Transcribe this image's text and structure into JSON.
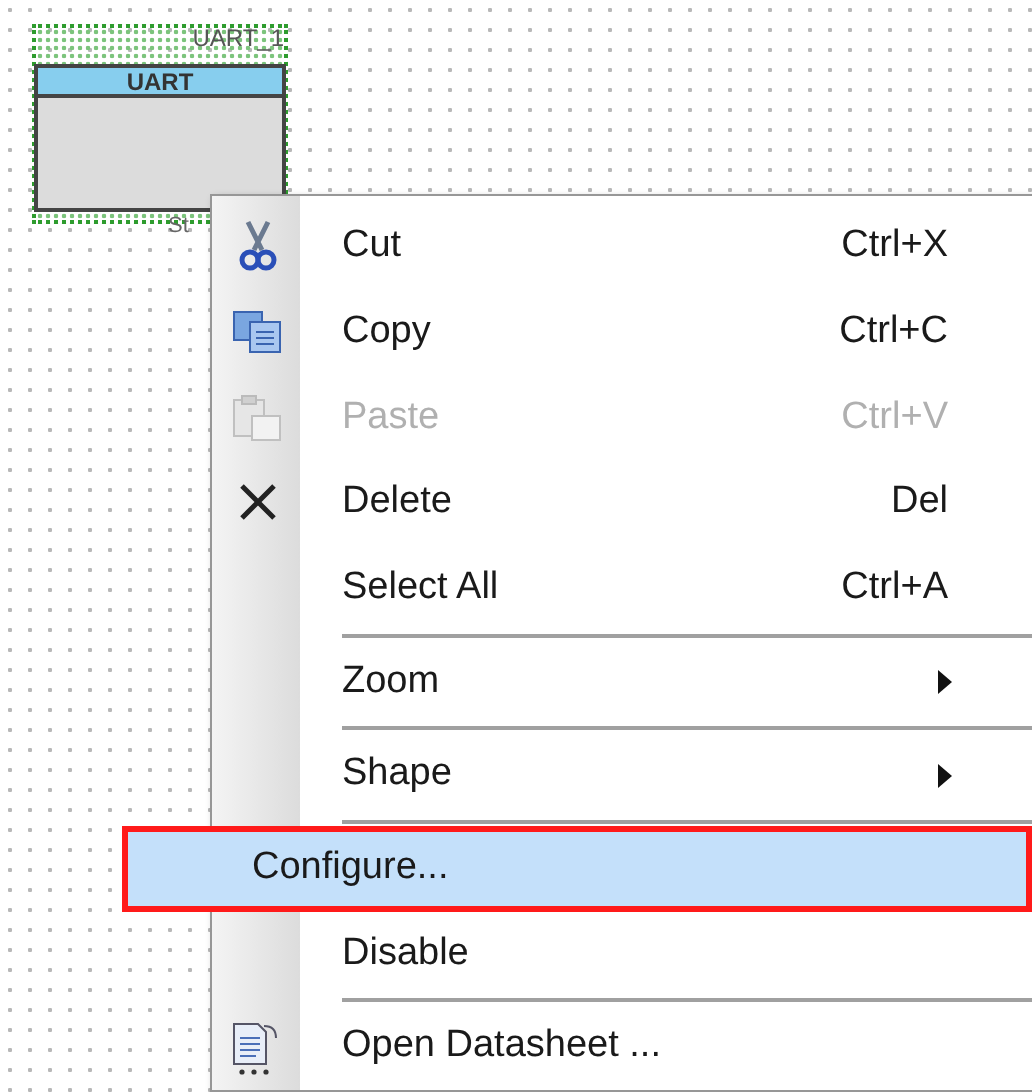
{
  "canvas": {
    "component": {
      "instance_name": "UART_1",
      "title": "UART",
      "terminal_label": "St",
      "selected": true
    }
  },
  "context_menu": {
    "items": [
      {
        "kind": "item",
        "label": "Cut",
        "shortcut": "Ctrl+X",
        "disabled": false,
        "selected": false
      },
      {
        "kind": "item",
        "label": "Copy",
        "shortcut": "Ctrl+C",
        "disabled": false,
        "selected": false
      },
      {
        "kind": "item",
        "label": "Paste",
        "shortcut": "Ctrl+V",
        "disabled": true,
        "selected": false
      },
      {
        "kind": "item",
        "label": "Delete",
        "shortcut": "Del",
        "disabled": false,
        "selected": false
      },
      {
        "kind": "item",
        "label": "Select All",
        "shortcut": "Ctrl+A",
        "disabled": false,
        "selected": false
      },
      {
        "kind": "separator"
      },
      {
        "kind": "submenu",
        "label": "Zoom",
        "disabled": false,
        "selected": false
      },
      {
        "kind": "separator"
      },
      {
        "kind": "submenu",
        "label": "Shape",
        "disabled": false,
        "selected": false
      },
      {
        "kind": "separator"
      },
      {
        "kind": "item",
        "label": "Configure...",
        "disabled": false,
        "selected": true
      },
      {
        "kind": "item",
        "label": "Disable",
        "disabled": false,
        "selected": false
      },
      {
        "kind": "separator"
      },
      {
        "kind": "item",
        "label": "Open Datasheet ...",
        "disabled": false,
        "selected": false
      }
    ]
  }
}
